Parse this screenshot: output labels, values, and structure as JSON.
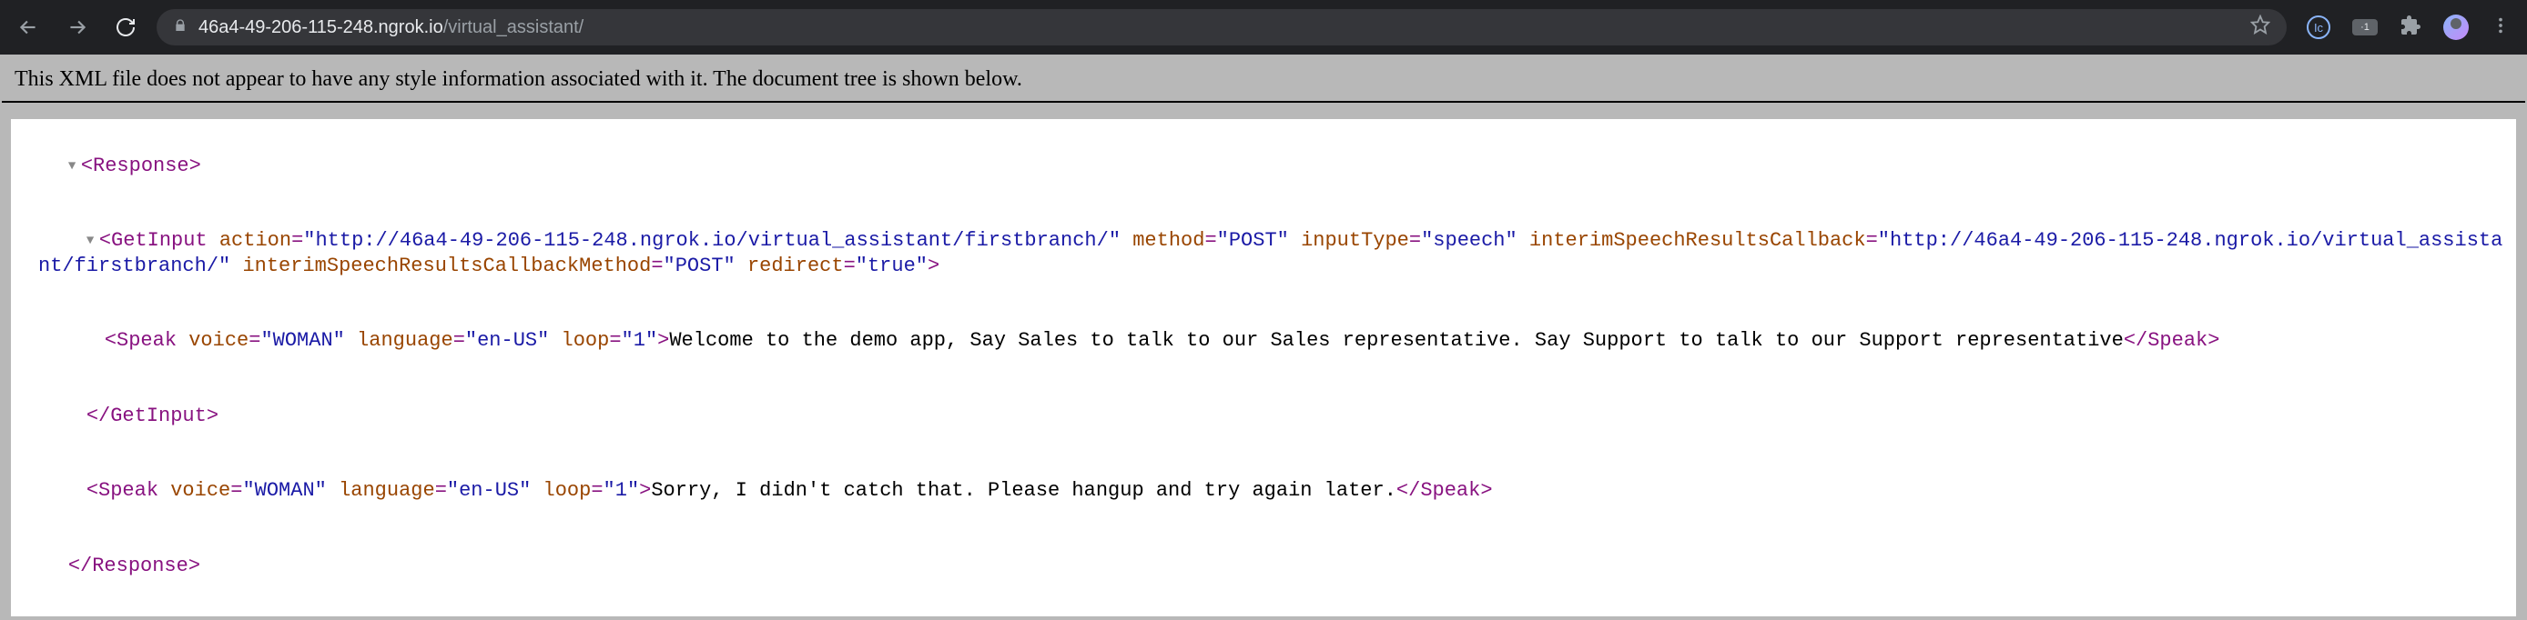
{
  "browser": {
    "url_host": "46a4-49-206-115-248.ngrok.io",
    "url_path": "/virtual_assistant/",
    "ext_badge": "·1",
    "ext_circle": "Ic"
  },
  "banner": "This XML file does not appear to have any style information associated with it. The document tree is shown below.",
  "xml": {
    "response_open": "Response",
    "response_close": "Response",
    "getinput": {
      "tag": "GetInput",
      "attrs": {
        "action": {
          "name": "action",
          "value": "http://46a4-49-206-115-248.ngrok.io/virtual_assistant/firstbranch/"
        },
        "method": {
          "name": "method",
          "value": "POST"
        },
        "inputType": {
          "name": "inputType",
          "value": "speech"
        },
        "interimCb": {
          "name": "interimSpeechResultsCallback",
          "value": "http://46a4-49-206-115-248.ngrok.io/virtual_assistant/firstbranch/"
        },
        "interimCbMethod": {
          "name": "interimSpeechResultsCallbackMethod",
          "value": "POST"
        },
        "redirect": {
          "name": "redirect",
          "value": "true"
        }
      },
      "close": "GetInput"
    },
    "speak1": {
      "tag": "Speak",
      "voice": {
        "name": "voice",
        "value": "WOMAN"
      },
      "language": {
        "name": "language",
        "value": "en-US"
      },
      "loop": {
        "name": "loop",
        "value": "1"
      },
      "text": "Welcome to the demo app, Say Sales to talk to our Sales representative. Say Support to talk to our Support representative",
      "close": "Speak"
    },
    "speak2": {
      "tag": "Speak",
      "voice": {
        "name": "voice",
        "value": "WOMAN"
      },
      "language": {
        "name": "language",
        "value": "en-US"
      },
      "loop": {
        "name": "loop",
        "value": "1"
      },
      "text": "Sorry, I didn't catch that. Please hangup and try again later.",
      "close": "Speak"
    }
  }
}
